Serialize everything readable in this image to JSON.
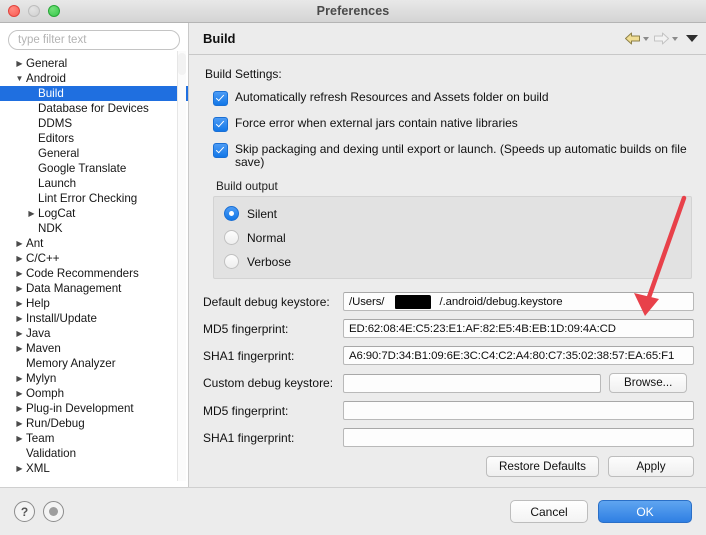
{
  "window": {
    "title": "Preferences",
    "controls": [
      "close",
      "minimize",
      "zoom"
    ]
  },
  "sidebar": {
    "filter_placeholder": "type filter text",
    "filter_value": "",
    "items": [
      {
        "label": "General",
        "level": 0,
        "twisty": "collapsed",
        "selected": false
      },
      {
        "label": "Android",
        "level": 0,
        "twisty": "expanded",
        "selected": false
      },
      {
        "label": "Build",
        "level": 1,
        "twisty": "none",
        "selected": true
      },
      {
        "label": "Database for Devices",
        "level": 1,
        "twisty": "none",
        "selected": false
      },
      {
        "label": "DDMS",
        "level": 1,
        "twisty": "none",
        "selected": false
      },
      {
        "label": "Editors",
        "level": 1,
        "twisty": "none",
        "selected": false
      },
      {
        "label": "General",
        "level": 1,
        "twisty": "none",
        "selected": false
      },
      {
        "label": "Google Translate",
        "level": 1,
        "twisty": "none",
        "selected": false
      },
      {
        "label": "Launch",
        "level": 1,
        "twisty": "none",
        "selected": false
      },
      {
        "label": "Lint Error Checking",
        "level": 1,
        "twisty": "none",
        "selected": false
      },
      {
        "label": "LogCat",
        "level": 2,
        "twisty": "collapsed",
        "selected": false
      },
      {
        "label": "NDK",
        "level": 1,
        "twisty": "none",
        "selected": false
      },
      {
        "label": "Ant",
        "level": 0,
        "twisty": "collapsed",
        "selected": false
      },
      {
        "label": "C/C++",
        "level": 0,
        "twisty": "collapsed",
        "selected": false
      },
      {
        "label": "Code Recommenders",
        "level": 0,
        "twisty": "collapsed",
        "selected": false
      },
      {
        "label": "Data Management",
        "level": 0,
        "twisty": "collapsed",
        "selected": false
      },
      {
        "label": "Help",
        "level": 0,
        "twisty": "collapsed",
        "selected": false
      },
      {
        "label": "Install/Update",
        "level": 0,
        "twisty": "collapsed",
        "selected": false
      },
      {
        "label": "Java",
        "level": 0,
        "twisty": "collapsed",
        "selected": false
      },
      {
        "label": "Maven",
        "level": 0,
        "twisty": "collapsed",
        "selected": false
      },
      {
        "label": "Memory Analyzer",
        "level": 0,
        "twisty": "none",
        "selected": false
      },
      {
        "label": "Mylyn",
        "level": 0,
        "twisty": "collapsed",
        "selected": false
      },
      {
        "label": "Oomph",
        "level": 0,
        "twisty": "collapsed",
        "selected": false
      },
      {
        "label": "Plug-in Development",
        "level": 0,
        "twisty": "collapsed",
        "selected": false
      },
      {
        "label": "Run/Debug",
        "level": 0,
        "twisty": "collapsed",
        "selected": false
      },
      {
        "label": "Team",
        "level": 0,
        "twisty": "collapsed",
        "selected": false
      },
      {
        "label": "Validation",
        "level": 0,
        "twisty": "none",
        "selected": false
      },
      {
        "label": "XML",
        "level": 0,
        "twisty": "collapsed",
        "selected": false
      }
    ]
  },
  "panel": {
    "title": "Build",
    "toolbar": {
      "back_icon": "back-arrow-icon",
      "forward_icon": "forward-arrow-icon",
      "menu_icon": "chevron-down-icon",
      "back_color": "#e8d27a",
      "forward_color": "#d8d8d8"
    },
    "settings_label": "Build Settings:",
    "checkboxes": [
      {
        "label": "Automatically refresh Resources and Assets folder on build",
        "checked": true
      },
      {
        "label": "Force error when external jars contain native libraries",
        "checked": true
      },
      {
        "label": "Skip packaging and dexing until export or launch. (Speeds up automatic builds on file save)",
        "checked": true
      }
    ],
    "build_output": {
      "group_title": "Build output",
      "options": [
        {
          "label": "Silent",
          "selected": true
        },
        {
          "label": "Normal",
          "selected": false
        },
        {
          "label": "Verbose",
          "selected": false
        }
      ]
    },
    "fields": [
      {
        "label": "Default debug keystore:",
        "value": "/Users/                  /.android/debug.keystore",
        "redacted": true
      },
      {
        "label": "MD5 fingerprint:",
        "value": "ED:62:08:4E:C5:23:E1:AF:82:E5:4B:EB:1D:09:4A:CD",
        "redacted": false
      },
      {
        "label": "SHA1 fingerprint:",
        "value": "A6:90:7D:34:B1:09:6E:3C:C4:C2:A4:80:C7:35:02:38:57:EA:65:F1",
        "redacted": false
      }
    ],
    "custom_keystore": {
      "label": "Custom debug keystore:",
      "value": "",
      "browse_label": "Browse..."
    },
    "custom_fields": [
      {
        "label": "MD5 fingerprint:",
        "value": ""
      },
      {
        "label": "SHA1 fingerprint:",
        "value": ""
      }
    ],
    "actions": {
      "restore_label": "Restore Defaults",
      "apply_label": "Apply"
    }
  },
  "footer": {
    "help_icon": "question-mark-icon",
    "help_glyph": "?",
    "secondary_icon": "record-circle-icon",
    "cancel_label": "Cancel",
    "ok_label": "OK",
    "ok_color": "#3f8ee8"
  },
  "annotation": {
    "arrow_color": "#e8414a",
    "target": "sha1-fingerprint-field"
  }
}
